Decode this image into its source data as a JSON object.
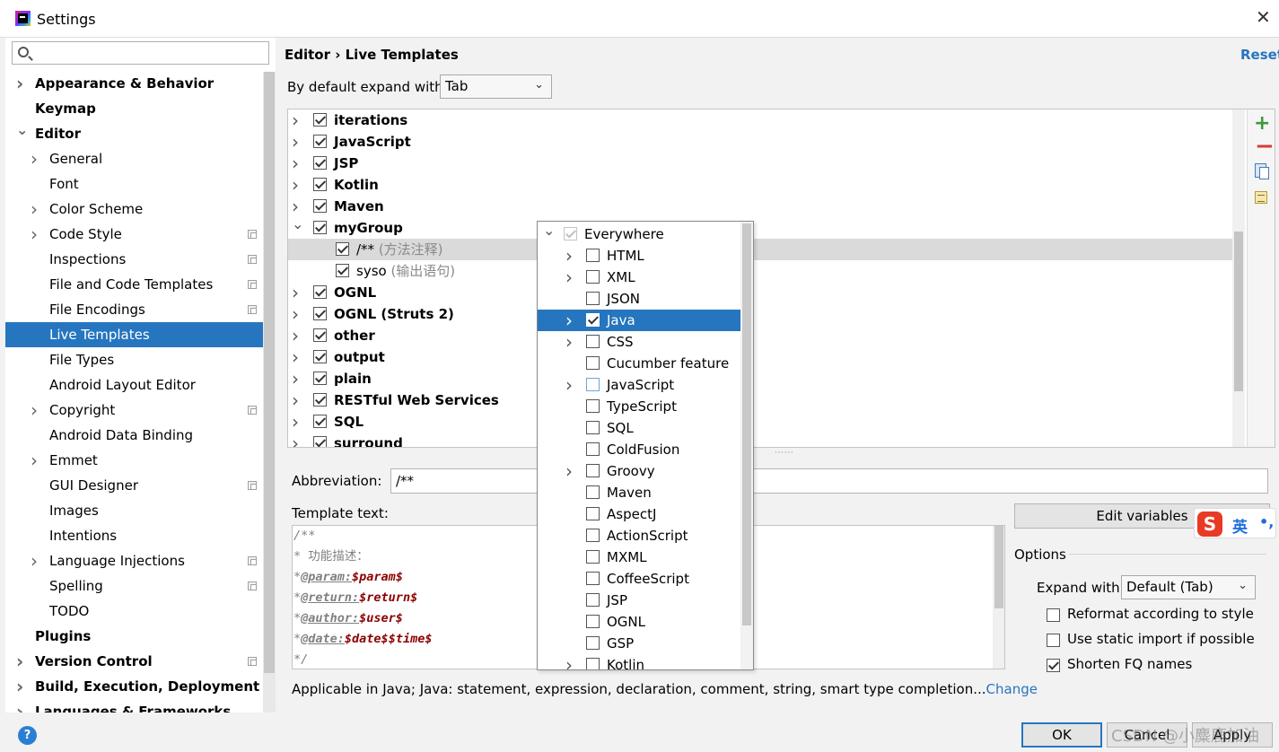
{
  "window": {
    "title": "Settings"
  },
  "sidebar": {
    "search_placeholder": "",
    "items": [
      {
        "label": "Appearance & Behavior",
        "bold": true,
        "level": 0,
        "chevron": "right",
        "copy": false
      },
      {
        "label": "Keymap",
        "bold": true,
        "level": 0,
        "chevron": "none",
        "copy": false
      },
      {
        "label": "Editor",
        "bold": true,
        "level": 0,
        "chevron": "down",
        "copy": false
      },
      {
        "label": "General",
        "bold": false,
        "level": 1,
        "chevron": "right",
        "copy": false
      },
      {
        "label": "Font",
        "bold": false,
        "level": 1,
        "chevron": "none",
        "copy": false
      },
      {
        "label": "Color Scheme",
        "bold": false,
        "level": 1,
        "chevron": "right",
        "copy": false
      },
      {
        "label": "Code Style",
        "bold": false,
        "level": 1,
        "chevron": "right",
        "copy": true
      },
      {
        "label": "Inspections",
        "bold": false,
        "level": 1,
        "chevron": "none",
        "copy": true
      },
      {
        "label": "File and Code Templates",
        "bold": false,
        "level": 1,
        "chevron": "none",
        "copy": true
      },
      {
        "label": "File Encodings",
        "bold": false,
        "level": 1,
        "chevron": "none",
        "copy": true
      },
      {
        "label": "Live Templates",
        "bold": false,
        "level": 1,
        "chevron": "none",
        "copy": false,
        "selected": true
      },
      {
        "label": "File Types",
        "bold": false,
        "level": 1,
        "chevron": "none",
        "copy": false
      },
      {
        "label": "Android Layout Editor",
        "bold": false,
        "level": 1,
        "chevron": "none",
        "copy": false
      },
      {
        "label": "Copyright",
        "bold": false,
        "level": 1,
        "chevron": "right",
        "copy": true
      },
      {
        "label": "Android Data Binding",
        "bold": false,
        "level": 1,
        "chevron": "none",
        "copy": false
      },
      {
        "label": "Emmet",
        "bold": false,
        "level": 1,
        "chevron": "right",
        "copy": false
      },
      {
        "label": "GUI Designer",
        "bold": false,
        "level": 1,
        "chevron": "none",
        "copy": true
      },
      {
        "label": "Images",
        "bold": false,
        "level": 1,
        "chevron": "none",
        "copy": false
      },
      {
        "label": "Intentions",
        "bold": false,
        "level": 1,
        "chevron": "none",
        "copy": false
      },
      {
        "label": "Language Injections",
        "bold": false,
        "level": 1,
        "chevron": "right",
        "copy": true
      },
      {
        "label": "Spelling",
        "bold": false,
        "level": 1,
        "chevron": "none",
        "copy": true
      },
      {
        "label": "TODO",
        "bold": false,
        "level": 1,
        "chevron": "none",
        "copy": false
      },
      {
        "label": "Plugins",
        "bold": true,
        "level": 0,
        "chevron": "none",
        "copy": false
      },
      {
        "label": "Version Control",
        "bold": true,
        "level": 0,
        "chevron": "right",
        "copy": true
      },
      {
        "label": "Build, Execution, Deployment",
        "bold": true,
        "level": 0,
        "chevron": "right",
        "copy": false
      },
      {
        "label": "Languages & Frameworks",
        "bold": true,
        "level": 0,
        "chevron": "right",
        "copy": false
      }
    ]
  },
  "header": {
    "breadcrumb": "Editor › Live Templates",
    "reset_label": "Reset"
  },
  "expand": {
    "label": "By default expand with",
    "value": "Tab"
  },
  "templates": [
    {
      "name": "iterations",
      "level": 0,
      "checked": true,
      "chevron": "right"
    },
    {
      "name": "JavaScript",
      "level": 0,
      "checked": true,
      "chevron": "right"
    },
    {
      "name": "JSP",
      "level": 0,
      "checked": true,
      "chevron": "right"
    },
    {
      "name": "Kotlin",
      "level": 0,
      "checked": true,
      "chevron": "right"
    },
    {
      "name": "Maven",
      "level": 0,
      "checked": true,
      "chevron": "right"
    },
    {
      "name": "myGroup",
      "level": 0,
      "checked": true,
      "chevron": "down"
    },
    {
      "name": "/**",
      "desc": " (方法注释)",
      "level": 1,
      "checked": true,
      "chevron": "none",
      "highlighted": true
    },
    {
      "name": "syso",
      "desc": " (输出语句)",
      "level": 1,
      "checked": true,
      "chevron": "none"
    },
    {
      "name": "OGNL",
      "level": 0,
      "checked": true,
      "chevron": "right"
    },
    {
      "name": "OGNL (Struts 2)",
      "level": 0,
      "checked": true,
      "chevron": "right"
    },
    {
      "name": "other",
      "level": 0,
      "checked": true,
      "chevron": "right"
    },
    {
      "name": "output",
      "level": 0,
      "checked": true,
      "chevron": "right"
    },
    {
      "name": "plain",
      "level": 0,
      "checked": true,
      "chevron": "right"
    },
    {
      "name": "RESTful Web Services",
      "level": 0,
      "checked": true,
      "chevron": "right"
    },
    {
      "name": "SQL",
      "level": 0,
      "checked": true,
      "chevron": "right"
    },
    {
      "name": "surround",
      "level": 0,
      "checked": true,
      "chevron": "right"
    }
  ],
  "editor": {
    "abbreviation_label": "Abbreviation:",
    "abbreviation_value": "/**",
    "template_text_label": "Template text:",
    "code_lines": [
      {
        "parts": [
          {
            "t": "/**",
            "c": "comment"
          }
        ]
      },
      {
        "parts": [
          {
            "t": " * 功能描述：",
            "c": "plain"
          }
        ]
      },
      {
        "parts": [
          {
            "t": " *",
            "c": "comment"
          },
          {
            "t": "@param:",
            "c": "tag"
          },
          {
            "t": "$param$",
            "c": "var"
          }
        ]
      },
      {
        "parts": [
          {
            "t": " *",
            "c": "comment"
          },
          {
            "t": "@return:",
            "c": "tag"
          },
          {
            "t": "$return$",
            "c": "var"
          }
        ]
      },
      {
        "parts": [
          {
            "t": " *",
            "c": "comment"
          },
          {
            "t": "@author:",
            "c": "tag"
          },
          {
            "t": "$user$",
            "c": "var"
          }
        ]
      },
      {
        "parts": [
          {
            "t": " *",
            "c": "comment"
          },
          {
            "t": "@date:",
            "c": "tag"
          },
          {
            "t": "$date$$time$",
            "c": "var"
          }
        ]
      },
      {
        "parts": [
          {
            "t": " */",
            "c": "comment"
          }
        ]
      }
    ],
    "applicable_text": "Applicable in Java; Java: statement, expression, declaration, comment, string, smart type completion...",
    "change_label": "Change"
  },
  "options": {
    "edit_variables_label": "Edit variables",
    "options_label": "Options",
    "expand_with_label": "Expand with",
    "expand_with_value": "Default (Tab)",
    "reformat_label": "Reformat according to style",
    "reformat_checked": false,
    "static_import_label": "Use static import if possible",
    "static_import_checked": false,
    "shorten_fq_label": "Shorten FQ names",
    "shorten_fq_checked": true
  },
  "context_popup": {
    "items": [
      {
        "name": "Everywhere",
        "level": 0,
        "checked": true,
        "disabled": true,
        "chevron": "down"
      },
      {
        "name": "HTML",
        "level": 1,
        "checked": false,
        "chevron": "right"
      },
      {
        "name": "XML",
        "level": 1,
        "checked": false,
        "chevron": "right"
      },
      {
        "name": "JSON",
        "level": 1,
        "checked": false,
        "chevron": "none"
      },
      {
        "name": "Java",
        "level": 1,
        "checked": true,
        "chevron": "right",
        "selected": true
      },
      {
        "name": "CSS",
        "level": 1,
        "checked": false,
        "chevron": "right"
      },
      {
        "name": "Cucumber feature",
        "level": 1,
        "checked": false,
        "chevron": "none"
      },
      {
        "name": "JavaScript",
        "level": 1,
        "checked": false,
        "chevron": "right",
        "blue": true
      },
      {
        "name": "TypeScript",
        "level": 1,
        "checked": false,
        "chevron": "none"
      },
      {
        "name": "SQL",
        "level": 1,
        "checked": false,
        "chevron": "none"
      },
      {
        "name": "ColdFusion",
        "level": 1,
        "checked": false,
        "chevron": "none"
      },
      {
        "name": "Groovy",
        "level": 1,
        "checked": false,
        "chevron": "right"
      },
      {
        "name": "Maven",
        "level": 1,
        "checked": false,
        "chevron": "none"
      },
      {
        "name": "AspectJ",
        "level": 1,
        "checked": false,
        "chevron": "none"
      },
      {
        "name": "ActionScript",
        "level": 1,
        "checked": false,
        "chevron": "none"
      },
      {
        "name": "MXML",
        "level": 1,
        "checked": false,
        "chevron": "none"
      },
      {
        "name": "CoffeeScript",
        "level": 1,
        "checked": false,
        "chevron": "none"
      },
      {
        "name": "JSP",
        "level": 1,
        "checked": false,
        "chevron": "none"
      },
      {
        "name": "OGNL",
        "level": 1,
        "checked": false,
        "chevron": "none"
      },
      {
        "name": "GSP",
        "level": 1,
        "checked": false,
        "chevron": "none"
      },
      {
        "name": "Kotlin",
        "level": 1,
        "checked": false,
        "chevron": "right"
      }
    ]
  },
  "ime": {
    "logo": "S",
    "text": "英",
    "dot": "•,"
  },
  "footer": {
    "ok_label": "OK",
    "cancel_label": "Cancel",
    "apply_label": "Apply",
    "help_label": "?",
    "watermark": "CSDN @小麋鹿加油"
  }
}
